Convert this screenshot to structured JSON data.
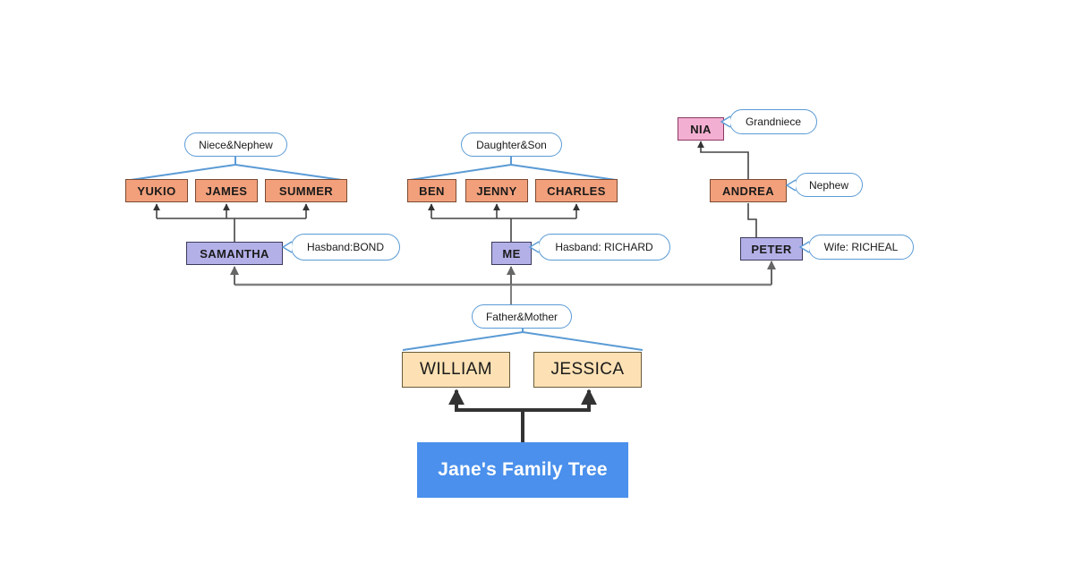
{
  "diagram": {
    "title": "Jane's Family Tree",
    "colors": {
      "root_fill": "#4a90ec",
      "root_text": "#ffffff",
      "parent_fill": "#fde1b4",
      "sibling_fill": "#b3b0e8",
      "children_fill": "#f2a07b",
      "grandniece_fill": "#f3afd1",
      "callout_border": "#5b9bd5",
      "connector_blue": "#5b9bd5",
      "connector_dark": "#333333",
      "connector_gray": "#808080"
    },
    "root": {
      "label": "Jane's Family Tree"
    },
    "parents": {
      "group_label": "Father&Mother",
      "members": [
        {
          "label": "WILLIAM"
        },
        {
          "label": "JESSICA"
        }
      ]
    },
    "generation_two": [
      {
        "label": "SAMANTHA",
        "callout": "Hasband:BOND"
      },
      {
        "label": "ME",
        "callout": "Hasband: RICHARD"
      },
      {
        "label": "PETER",
        "callout": "Wife: RICHEAL"
      }
    ],
    "branches": [
      {
        "parent": "SAMANTHA",
        "group_label": "Niece&Nephew",
        "children": [
          {
            "label": "YUKIO"
          },
          {
            "label": "JAMES"
          },
          {
            "label": "SUMMER"
          }
        ]
      },
      {
        "parent": "ME",
        "group_label": "Daughter&Son",
        "children": [
          {
            "label": "BEN"
          },
          {
            "label": "JENNY"
          },
          {
            "label": "CHARLES"
          }
        ]
      }
    ],
    "peter_line": [
      {
        "label": "ANDREA",
        "callout": "Nephew"
      },
      {
        "label": "NIA",
        "callout": "Grandniece"
      }
    ]
  }
}
